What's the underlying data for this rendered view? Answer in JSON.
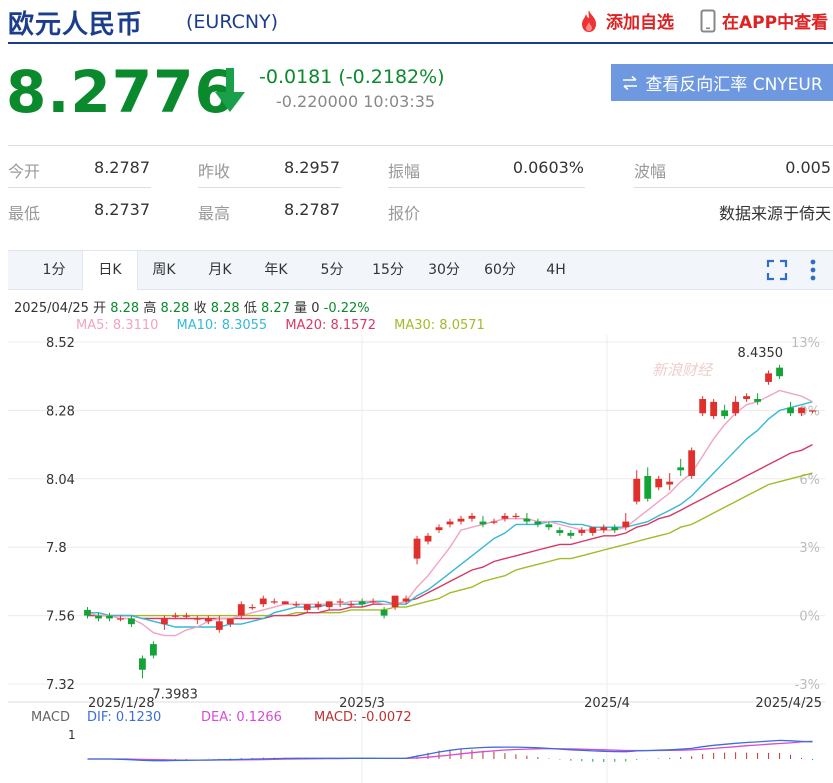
{
  "header": {
    "title": "欧元人民币",
    "symbol": "(EURCNY)",
    "favorite_label": "添加自选",
    "app_label": "在APP中查看"
  },
  "quote": {
    "price": "8.2776",
    "change": "-0.0181 (-0.2182%)",
    "subline": "-0.220000 10:03:35",
    "reverse_button": "查看反向汇率 CNYEUR"
  },
  "stats": {
    "open_label": "今开",
    "open": "8.2787",
    "prev_close_label": "昨收",
    "prev_close": "8.2957",
    "amplitude_label": "振幅",
    "amplitude": "0.0603%",
    "volatility_label": "波幅",
    "volatility": "0.005",
    "low_label": "最低",
    "low": "8.2737",
    "high_label": "最高",
    "high": "8.2787",
    "quote_label": "报价",
    "source": "数据来源于倚天"
  },
  "tabs": [
    "1分",
    "日K",
    "周K",
    "月K",
    "年K",
    "5分",
    "15分",
    "30分",
    "60分",
    "4H"
  ],
  "active_tab": "日K",
  "info": {
    "date": "2025/04/25",
    "open_label": "开",
    "open": "8.28",
    "high_label": "高",
    "high": "8.28",
    "close_label": "收",
    "close": "8.28",
    "low_label": "低",
    "low": "8.27",
    "vol_label": "量",
    "vol": "0",
    "pct": "-0.22%",
    "ma5": "MA5: 8.3110",
    "ma10": "MA10: 8.3055",
    "ma20": "MA20: 8.1572",
    "ma30": "MA30: 8.0571"
  },
  "macd": {
    "label": "MACD",
    "dif": "DIF: 0.1230",
    "dea": "DEA: 0.1266",
    "macd": "MACD: -0.0072",
    "axis_top": "1"
  },
  "watermark": "新浪财经",
  "colors": {
    "up": "#e0302c",
    "down": "#13a437",
    "ma5": "#f1a3c2",
    "ma10": "#35b9d8",
    "ma20": "#d63a64",
    "ma30": "#a3ba28",
    "dif": "#3b6fd6",
    "dea": "#d64ad8"
  },
  "chart_data": {
    "type": "candlestick",
    "y_ticks": [
      "8.52",
      "8.28",
      "8.04",
      "7.8",
      "7.56",
      "7.32"
    ],
    "ylim": [
      7.32,
      8.52
    ],
    "pct_ticks": [
      "13%",
      "9%",
      "6%",
      "3%",
      "0%",
      "-3%"
    ],
    "x_ticks": [
      "2025/1/28",
      "2025/3",
      "2025/4",
      "2025/4/25"
    ],
    "max_label": "8.4350",
    "min_label": "7.3983",
    "candles": [
      [
        7.58,
        7.59,
        7.56,
        7.55
      ],
      [
        7.56,
        7.57,
        7.55,
        7.54
      ],
      [
        7.56,
        7.57,
        7.55,
        7.54
      ],
      [
        7.55,
        7.56,
        7.55,
        7.54
      ],
      [
        7.55,
        7.56,
        7.53,
        7.52
      ],
      [
        7.41,
        7.42,
        7.37,
        7.34
      ],
      [
        7.46,
        7.47,
        7.42,
        7.41
      ],
      [
        7.53,
        7.56,
        7.55,
        7.51
      ],
      [
        7.56,
        7.57,
        7.56,
        7.55
      ],
      [
        7.56,
        7.57,
        7.56,
        7.55
      ],
      [
        7.55,
        7.56,
        7.55,
        7.53
      ],
      [
        7.54,
        7.56,
        7.55,
        7.53
      ],
      [
        7.51,
        7.56,
        7.54,
        7.5
      ],
      [
        7.53,
        7.55,
        7.55,
        7.52
      ],
      [
        7.56,
        7.61,
        7.6,
        7.55
      ],
      [
        7.59,
        7.6,
        7.59,
        7.58
      ],
      [
        7.6,
        7.63,
        7.62,
        7.59
      ],
      [
        7.61,
        7.62,
        7.61,
        7.6
      ],
      [
        7.6,
        7.61,
        7.61,
        7.6
      ],
      [
        7.6,
        7.61,
        7.6,
        7.59
      ],
      [
        7.58,
        7.6,
        7.6,
        7.57
      ],
      [
        7.59,
        7.61,
        7.6,
        7.58
      ],
      [
        7.59,
        7.61,
        7.61,
        7.58
      ],
      [
        7.61,
        7.62,
        7.61,
        7.59
      ],
      [
        7.6,
        7.61,
        7.6,
        7.59
      ],
      [
        7.61,
        7.62,
        7.6,
        7.59
      ],
      [
        7.61,
        7.62,
        7.61,
        7.6
      ],
      [
        7.58,
        7.59,
        7.56,
        7.55
      ],
      [
        7.59,
        7.63,
        7.63,
        7.58
      ],
      [
        7.61,
        7.63,
        7.62,
        7.6
      ],
      [
        7.76,
        7.84,
        7.83,
        7.74
      ],
      [
        7.82,
        7.85,
        7.84,
        7.81
      ],
      [
        7.86,
        7.88,
        7.87,
        7.85
      ],
      [
        7.88,
        7.9,
        7.89,
        7.87
      ],
      [
        7.89,
        7.91,
        7.9,
        7.88
      ],
      [
        7.9,
        7.92,
        7.91,
        7.89
      ],
      [
        7.89,
        7.91,
        7.88,
        7.87
      ],
      [
        7.89,
        7.9,
        7.89,
        7.88
      ],
      [
        7.9,
        7.92,
        7.91,
        7.89
      ],
      [
        7.91,
        7.92,
        7.91,
        7.9
      ],
      [
        7.9,
        7.92,
        7.89,
        7.88
      ],
      [
        7.89,
        7.9,
        7.88,
        7.87
      ],
      [
        7.88,
        7.89,
        7.87,
        7.86
      ],
      [
        7.86,
        7.87,
        7.85,
        7.84
      ],
      [
        7.85,
        7.86,
        7.84,
        7.83
      ],
      [
        7.85,
        7.87,
        7.86,
        7.84
      ],
      [
        7.85,
        7.87,
        7.87,
        7.84
      ],
      [
        7.86,
        7.88,
        7.87,
        7.85
      ],
      [
        7.87,
        7.88,
        7.86,
        7.85
      ],
      [
        7.87,
        7.92,
        7.89,
        7.86
      ],
      [
        7.96,
        8.07,
        8.04,
        7.95
      ],
      [
        8.05,
        8.08,
        7.97,
        7.96
      ],
      [
        8.01,
        8.05,
        8.04,
        8.0
      ],
      [
        8.02,
        8.06,
        8.03,
        8.0
      ],
      [
        8.08,
        8.11,
        8.07,
        8.05
      ],
      [
        8.05,
        8.15,
        8.14,
        8.04
      ],
      [
        8.27,
        8.33,
        8.32,
        8.26
      ],
      [
        8.26,
        8.32,
        8.31,
        8.25
      ],
      [
        8.28,
        8.3,
        8.26,
        8.25
      ],
      [
        8.27,
        8.33,
        8.31,
        8.26
      ],
      [
        8.32,
        8.34,
        8.33,
        8.31
      ],
      [
        8.32,
        8.34,
        8.31,
        8.3
      ],
      [
        8.38,
        8.42,
        8.41,
        8.37
      ],
      [
        8.43,
        8.44,
        8.4,
        8.39
      ],
      [
        8.29,
        8.31,
        8.27,
        8.26
      ],
      [
        8.27,
        8.29,
        8.29,
        8.26
      ],
      [
        8.28,
        8.28,
        8.28,
        8.27
      ]
    ],
    "ma5": [
      7.57,
      7.56,
      7.56,
      7.55,
      7.55,
      7.53,
      7.5,
      7.49,
      7.49,
      7.51,
      7.52,
      7.54,
      7.55,
      7.55,
      7.56,
      7.57,
      7.58,
      7.59,
      7.6,
      7.6,
      7.6,
      7.6,
      7.6,
      7.6,
      7.61,
      7.61,
      7.61,
      7.6,
      7.6,
      7.61,
      7.66,
      7.7,
      7.75,
      7.8,
      7.86,
      7.87,
      7.88,
      7.89,
      7.9,
      7.9,
      7.9,
      7.89,
      7.89,
      7.88,
      7.87,
      7.86,
      7.86,
      7.86,
      7.86,
      7.87,
      7.9,
      7.93,
      7.96,
      7.99,
      8.03,
      8.06,
      8.12,
      8.18,
      8.23,
      8.27,
      8.3,
      8.31,
      8.33,
      8.35,
      8.34,
      8.33,
      8.31
    ],
    "ma10": [
      7.57,
      7.57,
      7.56,
      7.56,
      7.56,
      7.55,
      7.54,
      7.53,
      7.52,
      7.52,
      7.52,
      7.52,
      7.52,
      7.53,
      7.53,
      7.54,
      7.55,
      7.57,
      7.58,
      7.59,
      7.59,
      7.59,
      7.6,
      7.6,
      7.6,
      7.6,
      7.61,
      7.61,
      7.6,
      7.6,
      7.63,
      7.65,
      7.68,
      7.71,
      7.74,
      7.77,
      7.8,
      7.83,
      7.85,
      7.88,
      7.88,
      7.88,
      7.89,
      7.89,
      7.88,
      7.88,
      7.87,
      7.87,
      7.87,
      7.87,
      7.88,
      7.89,
      7.91,
      7.93,
      7.95,
      7.98,
      8.02,
      8.06,
      8.1,
      8.14,
      8.18,
      8.21,
      8.25,
      8.28,
      8.29,
      8.3,
      8.31
    ],
    "ma20": [
      7.56,
      7.56,
      7.56,
      7.56,
      7.56,
      7.55,
      7.55,
      7.55,
      7.55,
      7.55,
      7.55,
      7.55,
      7.55,
      7.55,
      7.55,
      7.55,
      7.55,
      7.56,
      7.56,
      7.56,
      7.57,
      7.57,
      7.58,
      7.58,
      7.59,
      7.59,
      7.6,
      7.6,
      7.6,
      7.61,
      7.62,
      7.64,
      7.66,
      7.68,
      7.7,
      7.72,
      7.73,
      7.75,
      7.76,
      7.77,
      7.78,
      7.79,
      7.8,
      7.81,
      7.81,
      7.82,
      7.83,
      7.84,
      7.84,
      7.85,
      7.87,
      7.88,
      7.9,
      7.91,
      7.93,
      7.95,
      7.97,
      7.99,
      8.01,
      8.03,
      8.05,
      8.07,
      8.09,
      8.11,
      8.13,
      8.14,
      8.16
    ],
    "ma30": [
      7.56,
      7.56,
      7.56,
      7.56,
      7.56,
      7.56,
      7.56,
      7.56,
      7.56,
      7.56,
      7.56,
      7.56,
      7.56,
      7.56,
      7.56,
      7.56,
      7.56,
      7.56,
      7.56,
      7.57,
      7.57,
      7.57,
      7.57,
      7.57,
      7.58,
      7.58,
      7.58,
      7.58,
      7.59,
      7.59,
      7.6,
      7.61,
      7.62,
      7.64,
      7.65,
      7.66,
      7.68,
      7.69,
      7.7,
      7.72,
      7.73,
      7.74,
      7.75,
      7.76,
      7.76,
      7.77,
      7.78,
      7.79,
      7.8,
      7.81,
      7.82,
      7.83,
      7.84,
      7.85,
      7.87,
      7.88,
      7.9,
      7.92,
      7.94,
      7.96,
      7.98,
      8.0,
      8.02,
      8.03,
      8.04,
      8.05,
      8.06
    ],
    "macd_dif": [
      0,
      0,
      0,
      -0.002,
      -0.005,
      -0.01,
      -0.012,
      -0.012,
      -0.011,
      -0.01,
      -0.008,
      -0.007,
      -0.006,
      -0.005,
      -0.003,
      -0.001,
      0.001,
      0.003,
      0.004,
      0.005,
      0.005,
      0.005,
      0.005,
      0.005,
      0.005,
      0.005,
      0.005,
      0.004,
      0.004,
      0.005,
      0.02,
      0.035,
      0.05,
      0.062,
      0.072,
      0.078,
      0.082,
      0.084,
      0.085,
      0.085,
      0.083,
      0.08,
      0.076,
      0.071,
      0.066,
      0.062,
      0.058,
      0.055,
      0.053,
      0.052,
      0.058,
      0.06,
      0.063,
      0.066,
      0.07,
      0.076,
      0.088,
      0.098,
      0.105,
      0.112,
      0.118,
      0.122,
      0.128,
      0.133,
      0.13,
      0.126,
      0.123
    ],
    "macd_dea": [
      0,
      0,
      0,
      0,
      -0.001,
      -0.003,
      -0.005,
      -0.006,
      -0.007,
      -0.008,
      -0.008,
      -0.008,
      -0.007,
      -0.007,
      -0.006,
      -0.005,
      -0.004,
      -0.002,
      -0.001,
      0,
      0.001,
      0.002,
      0.003,
      0.003,
      0.004,
      0.004,
      0.004,
      0.004,
      0.004,
      0.004,
      0.007,
      0.013,
      0.02,
      0.028,
      0.037,
      0.045,
      0.052,
      0.058,
      0.064,
      0.068,
      0.071,
      0.073,
      0.074,
      0.073,
      0.072,
      0.07,
      0.068,
      0.066,
      0.063,
      0.061,
      0.061,
      0.061,
      0.061,
      0.062,
      0.063,
      0.066,
      0.07,
      0.076,
      0.082,
      0.088,
      0.095,
      0.1,
      0.106,
      0.111,
      0.115,
      0.122,
      0.1266
    ]
  }
}
